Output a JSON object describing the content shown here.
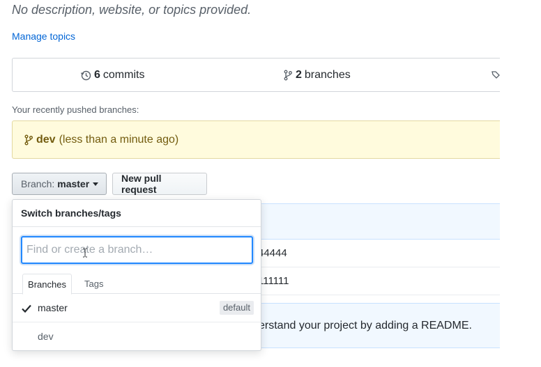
{
  "repo": {
    "description": "No description, website, or topics provided.",
    "manage_topics": "Manage topics"
  },
  "summary": {
    "commits_count": "6",
    "commits_label": "commits",
    "branches_count": "2",
    "branches_label": "branches"
  },
  "recent": {
    "label": "Your recently pushed branches:",
    "branch": "dev",
    "time": "(less than a minute ago)"
  },
  "toolbar": {
    "branch_prefix": "Branch:",
    "branch_current": "master",
    "new_pr": "New pull request"
  },
  "files": {
    "row1": "44444",
    "row2": "111111",
    "readme_text": "erstand your project by adding a README."
  },
  "dropdown": {
    "header": "Switch branches/tags",
    "filter_placeholder": "Find or create a branch…",
    "tabs": [
      "Branches",
      "Tags"
    ],
    "items": [
      {
        "name": "master",
        "badge": "default",
        "selected": true
      },
      {
        "name": "dev"
      }
    ]
  },
  "colors": {
    "link": "#0366d6",
    "focus": "#2188ff",
    "recent_bg": "#fffbdd",
    "info_bg": "#f1f8ff"
  }
}
